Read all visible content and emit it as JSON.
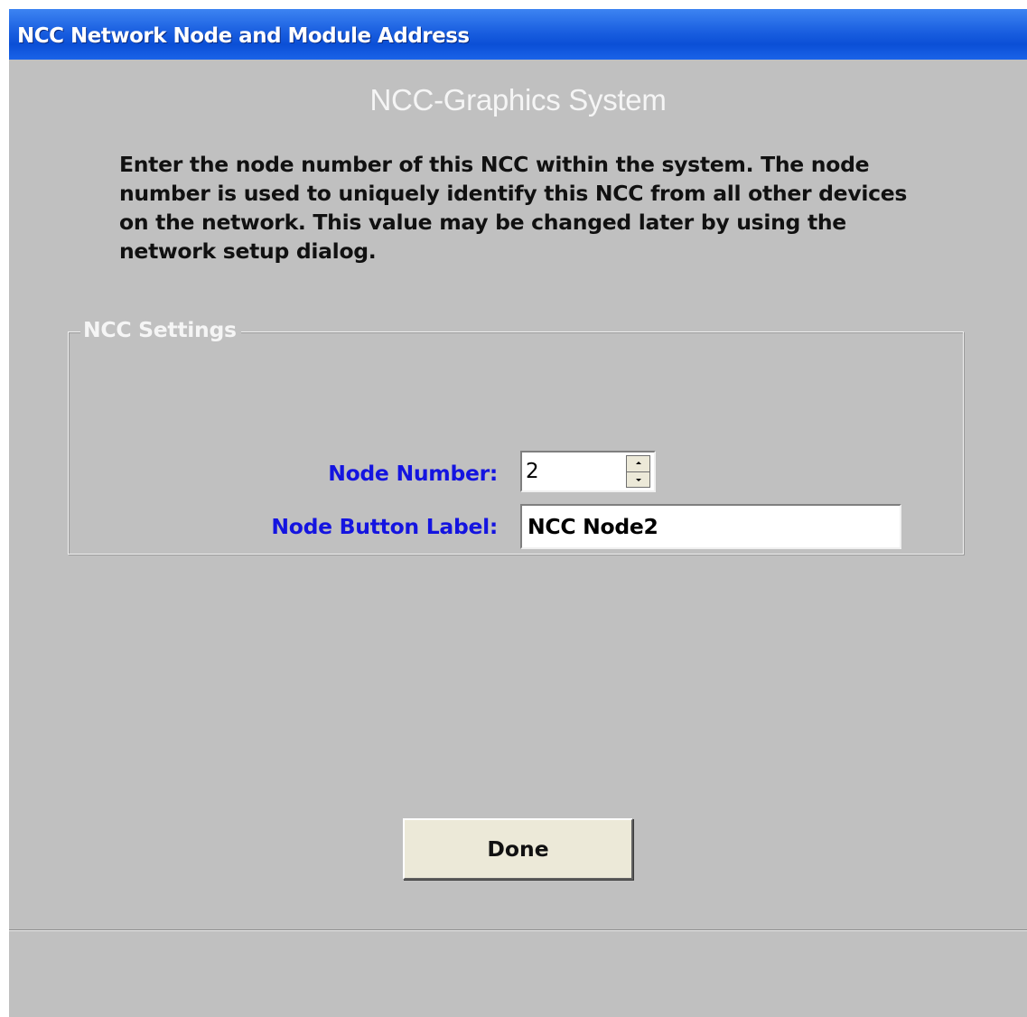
{
  "window": {
    "title": "NCC Network Node and Module Address"
  },
  "main": {
    "heading": "NCC-Graphics System",
    "instructions": "Enter the node number of this NCC within the system.  The node number is used to uniquely identify this NCC from all other devices on the network.  This value may be changed later by using the network setup dialog."
  },
  "settings": {
    "legend": "NCC Settings",
    "node_number_label": "Node Number:",
    "node_number_value": "2",
    "node_button_label_label": "Node Button Label:",
    "node_button_label_value": "NCC Node2"
  },
  "footer": {
    "done_label": "Done"
  },
  "colors": {
    "titlebar": "#0b4fd6",
    "background": "#c0c0c0",
    "field_label": "#1414e0"
  }
}
